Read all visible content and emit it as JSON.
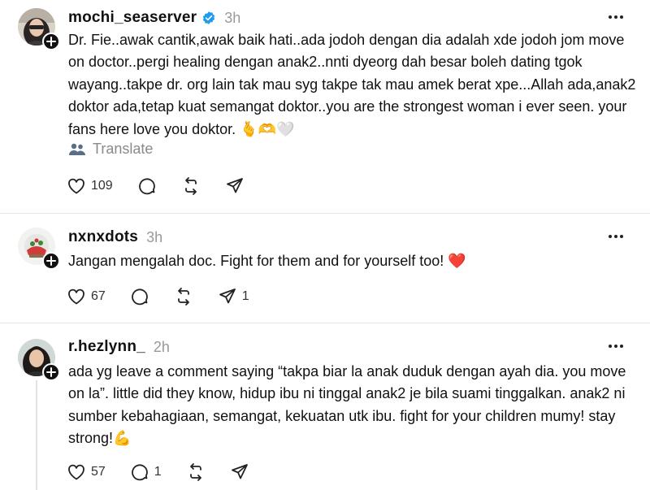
{
  "posts": [
    {
      "username": "mochi_seaserver",
      "verified": true,
      "time": "3h",
      "text": "Dr. Fie..awak cantik,awak baik hati..ada jodoh dengan dia adalah xde jodoh jom move on doctor..pergi healing dengan anak2..nnti dyeorg dah besar boleh dating tgok wayang..takpe dr. org lain tak mau syg takpe tak mau amek berat xpe...Allah ada,anak2 doktor ada,tetap kuat semangat doktor..you are the strongest woman i ever seen. your fans here love you doktor. 🫰🫶🤍",
      "translate_label": "Translate",
      "likes": "109",
      "replies": "",
      "reposts": "",
      "shares": ""
    },
    {
      "username": "nxnxdots",
      "verified": false,
      "time": "3h",
      "text": "Jangan mengalah doc. Fight for them and for yourself too! ❤️",
      "likes": "67",
      "replies": "",
      "reposts": "",
      "shares": "1"
    },
    {
      "username": "r.hezlynn_",
      "verified": false,
      "time": "2h",
      "text": "ada yg leave a comment saying “takpa biar la anak duduk dengan ayah dia. you move on la”. little did they know, hidup ibu ni tinggal anak2 je bila suami tinggalkan. anak2 ni sumber kebahagiaan, semangat, kekuatan utk ibu. fight for your children mumy! stay strong!💪",
      "likes": "57",
      "replies": "1",
      "reposts": "",
      "shares": ""
    }
  ],
  "icons": {
    "like": "heart-icon",
    "reply": "comment-icon",
    "repost": "repost-icon",
    "share": "send-icon",
    "more": "more-icon",
    "follow": "plus-icon",
    "translate": "translate-icon",
    "verified": "verified-badge-icon"
  },
  "colors": {
    "verified": "#1d9bf0",
    "muted": "#999999",
    "divider": "#e4e4e4"
  }
}
